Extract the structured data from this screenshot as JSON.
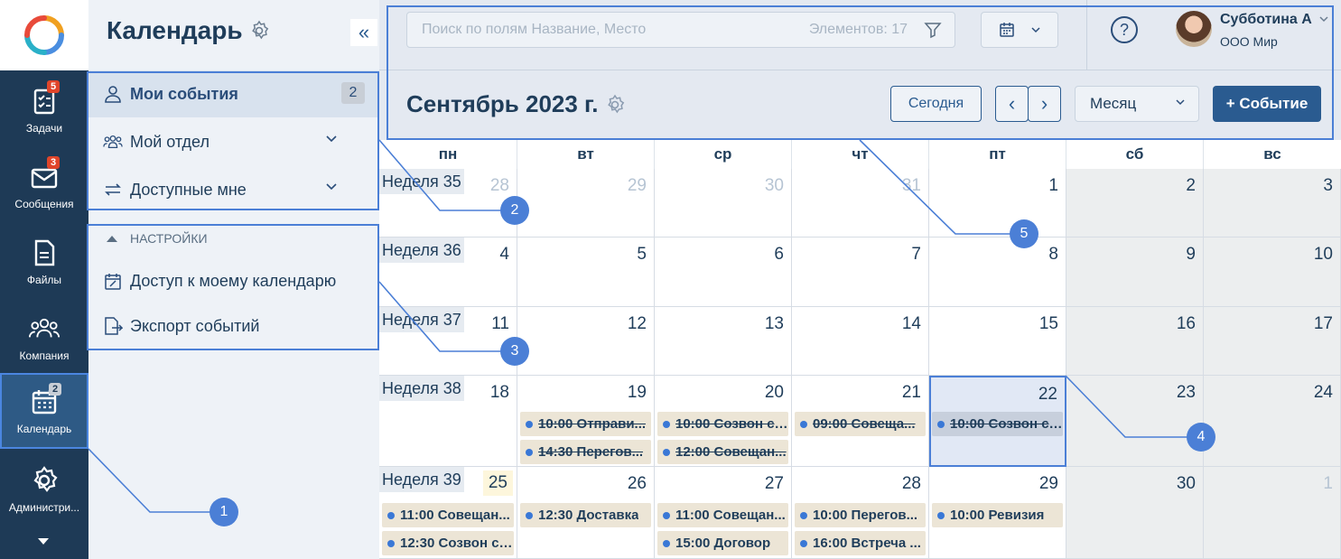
{
  "rail": {
    "items": [
      {
        "label": "Задачи",
        "badge": "5",
        "icon": "tasks-icon"
      },
      {
        "label": "Сообщения",
        "badge": "3",
        "icon": "envelope-icon"
      },
      {
        "label": "Файлы",
        "badge": "",
        "icon": "file-icon"
      },
      {
        "label": "Компания",
        "badge": "",
        "icon": "people-icon"
      },
      {
        "label": "Календарь",
        "badge": "2",
        "icon": "calendar-icon"
      },
      {
        "label": "Администри...",
        "badge": "",
        "icon": "gear-icon"
      }
    ]
  },
  "sidebar": {
    "title": "Календарь",
    "collapse": "«",
    "my_events": {
      "label": "Мои события",
      "count": "2"
    },
    "my_department": "Мой отдел",
    "available": "Доступные мне",
    "settings_header": "НАСТРОЙКИ",
    "access": "Доступ к моему календарю",
    "export": "Экспорт событий"
  },
  "toolbar": {
    "search_placeholder": "Поиск по полям Название, Место",
    "search_count": "Элементов: 17",
    "user_name": "Субботина А",
    "user_org": "ООО Мир",
    "month_title": "Сентябрь 2023 г.",
    "today": "Сегодня",
    "prev": "‹",
    "next": "›",
    "view": "Месяц",
    "add_event": "+ Событие",
    "help": "?"
  },
  "calendar": {
    "weekdays": [
      "пн",
      "вт",
      "ср",
      "чт",
      "пт",
      "сб",
      "вс"
    ],
    "weeks": [
      {
        "label": "Неделя 35",
        "days": [
          "28",
          "29",
          "30",
          "31",
          "1",
          "2",
          "3"
        ]
      },
      {
        "label": "Неделя 36",
        "days": [
          "4",
          "5",
          "6",
          "7",
          "8",
          "9",
          "10"
        ]
      },
      {
        "label": "Неделя 37",
        "days": [
          "11",
          "12",
          "13",
          "14",
          "15",
          "16",
          "17"
        ]
      },
      {
        "label": "Неделя 38",
        "days": [
          "18",
          "19",
          "20",
          "21",
          "22",
          "23",
          "24"
        ]
      },
      {
        "label": "Неделя 39",
        "days": [
          "25",
          "26",
          "27",
          "28",
          "29",
          "30",
          "1"
        ]
      }
    ],
    "events": {
      "w38_tue_1": "10:00 Отправи...",
      "w38_tue_2": "14:30 Перегов...",
      "w38_wed_1": "10:00 Созвон с ...",
      "w38_wed_2": "12:00 Совещан...",
      "w38_thu_1": "09:00 Совеща...",
      "w38_fri_1": "10:00 Созвон с ...",
      "w39_mon_1": "11:00 Совещан...",
      "w39_mon_2": "12:30 Созвон с ...",
      "w39_tue_1": "12:30 Доставка",
      "w39_wed_1": "11:00 Совещан...",
      "w39_wed_2": "15:00 Договор",
      "w39_thu_1": "10:00 Перегов...",
      "w39_thu_2": "16:00 Встреча ...",
      "w39_fri_1": "10:00 Ревизия"
    }
  },
  "callouts": [
    "1",
    "2",
    "3",
    "4",
    "5"
  ],
  "colors": {
    "rail": "#1e3a56",
    "accent": "#2a5b90",
    "highlight": "#4b7fd6",
    "event": "#ece5d6"
  }
}
